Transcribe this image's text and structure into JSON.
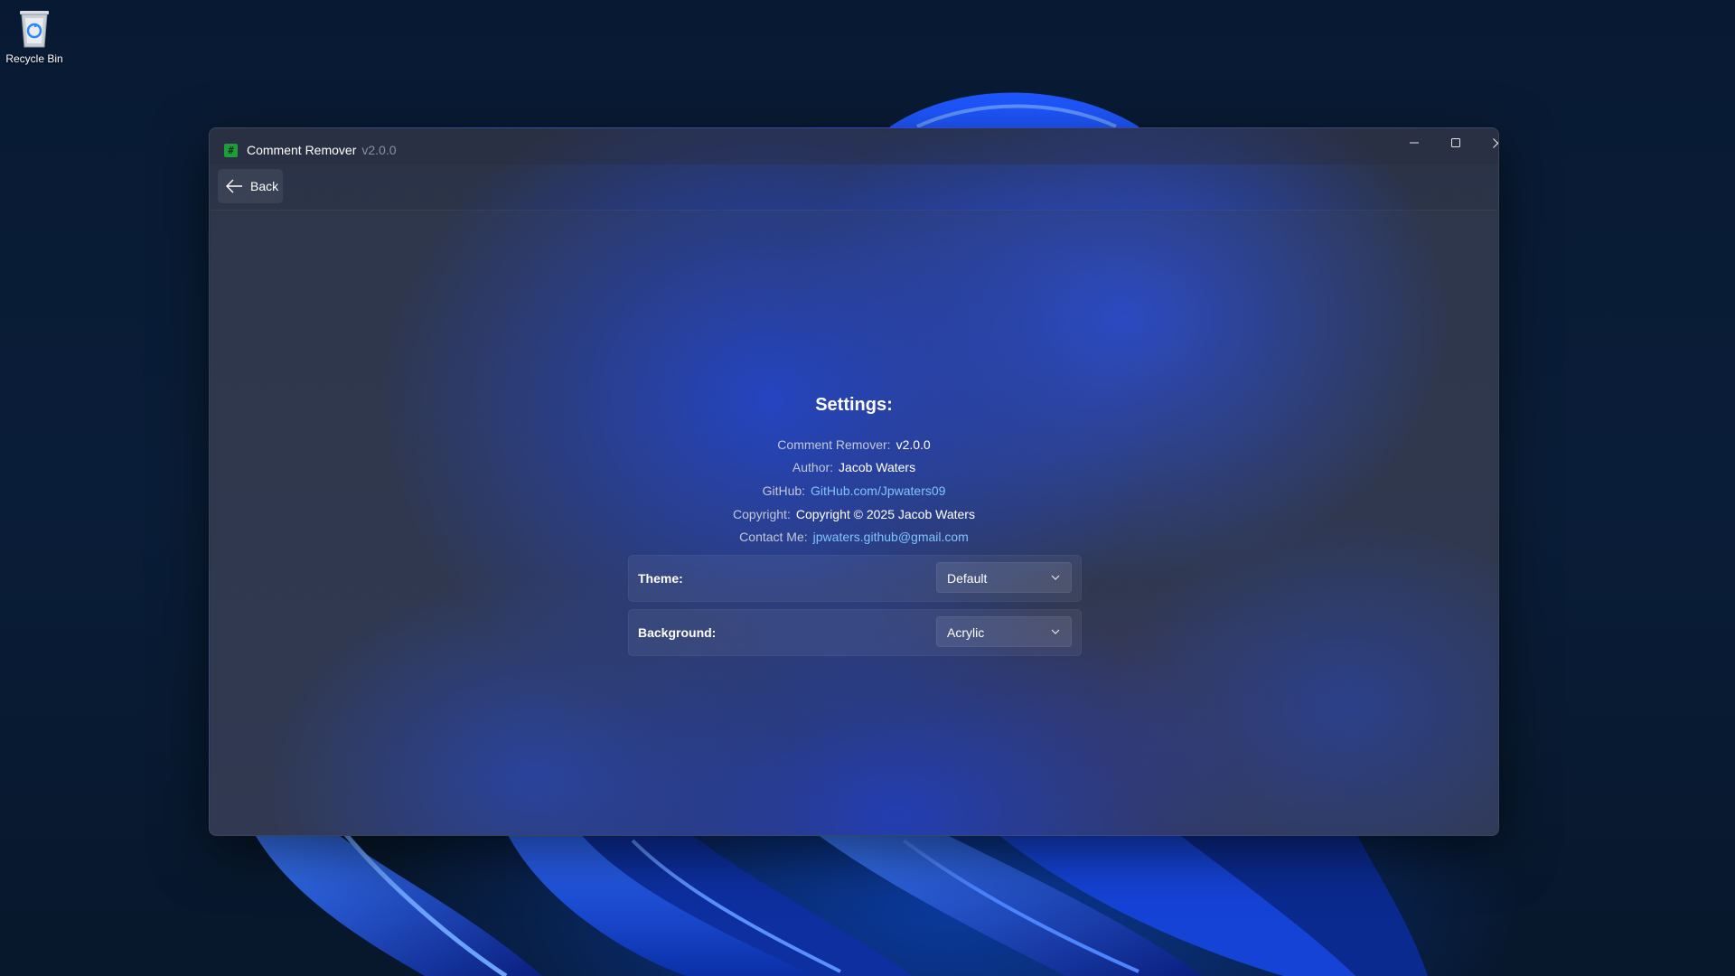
{
  "desktop": {
    "icons": [
      {
        "label": "Recycle Bin",
        "icon": "recycle-bin-icon"
      }
    ]
  },
  "window": {
    "title": "Comment Remover",
    "version": "v2.0.0",
    "app_icon": "#",
    "back_label": "Back"
  },
  "settings": {
    "heading": "Settings:",
    "info": {
      "app_label": "Comment Remover:",
      "app_value": "v2.0.0",
      "author_label": "Author:",
      "author_value": "Jacob Waters",
      "github_label": "GitHub:",
      "github_value": "GitHub.com/Jpwaters09",
      "copyright_label": "Copyright:",
      "copyright_value": "Copyright © 2025 Jacob Waters",
      "contact_label": "Contact Me:",
      "contact_value": "jpwaters.github@gmail.com"
    },
    "theme": {
      "label": "Theme:",
      "selected": "Default"
    },
    "background": {
      "label": "Background:",
      "selected": "Acrylic"
    }
  },
  "colors": {
    "link": "#7fc4ff",
    "app_icon": "#1f9d3c"
  }
}
